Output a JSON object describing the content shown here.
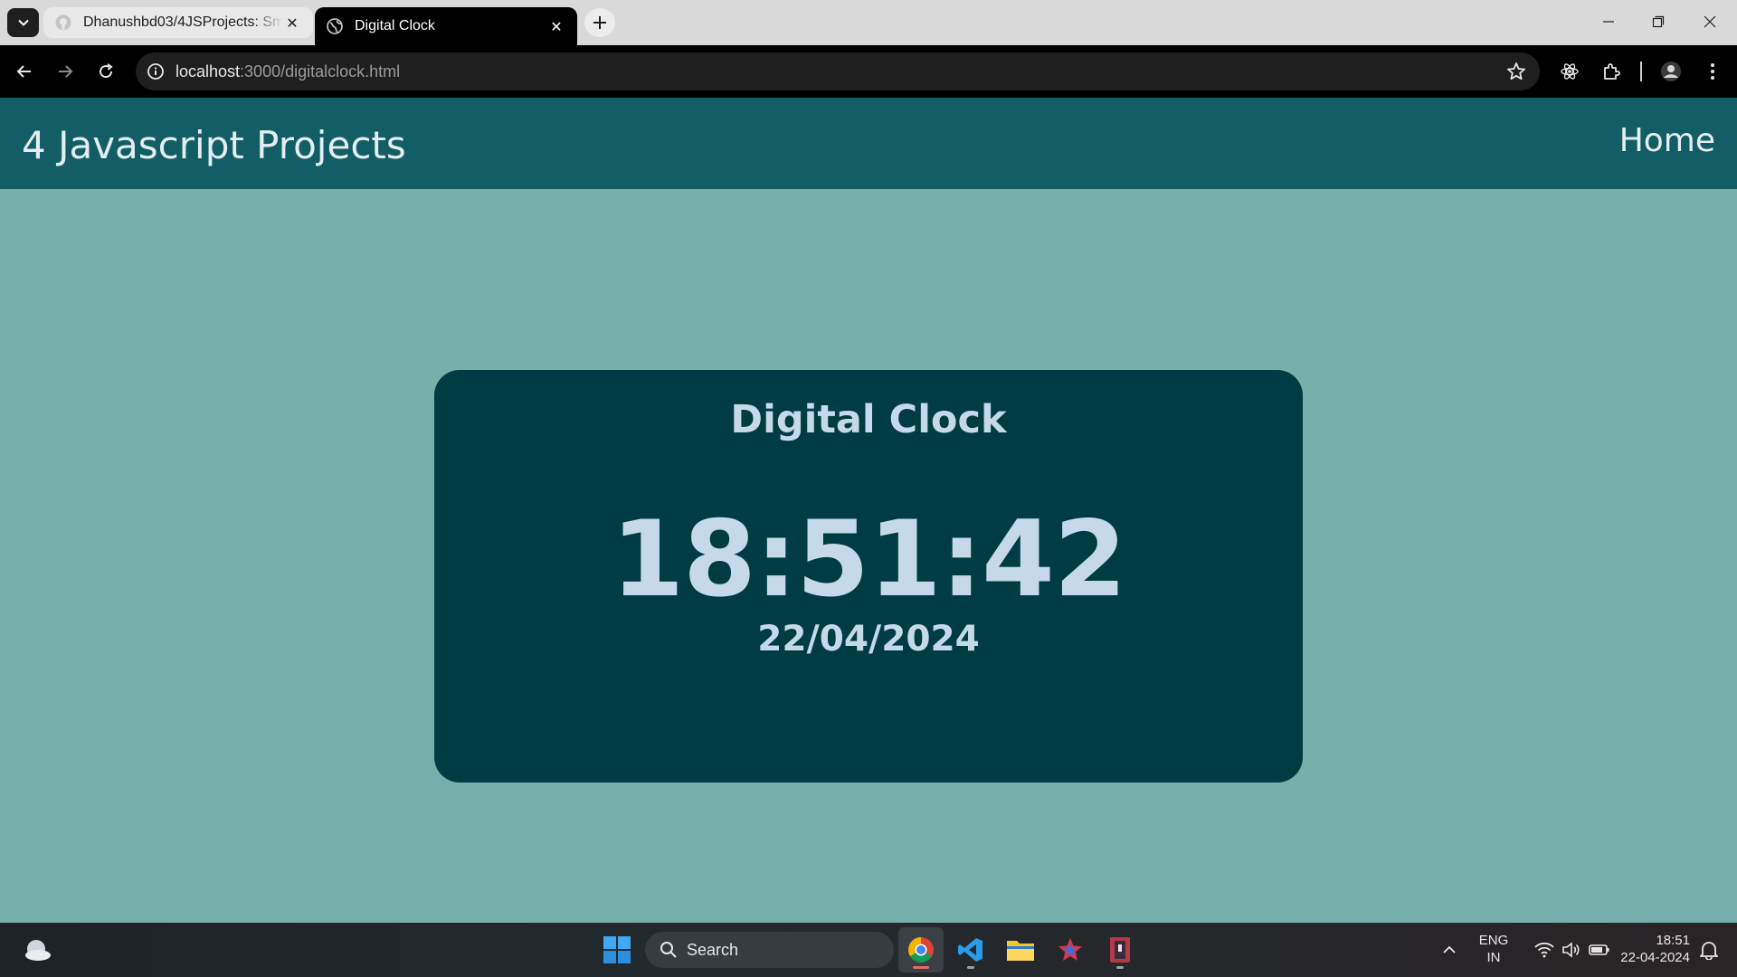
{
  "browser": {
    "tabs": [
      {
        "title": "Dhanushbd03/4JSProjects: Sm",
        "favicon": "github-icon",
        "active": false
      },
      {
        "title": "Digital Clock",
        "favicon": "globe-icon",
        "active": true
      }
    ],
    "url_host": "localhost",
    "url_rest": ":3000/digitalclock.html"
  },
  "site": {
    "title": "4 Javascript Projects",
    "nav_home": "Home"
  },
  "clock": {
    "heading": "Digital Clock",
    "time": "18:51:42",
    "date": "22/04/2024"
  },
  "taskbar": {
    "search_placeholder": "Search",
    "lang_line1": "ENG",
    "lang_line2": "IN",
    "time": "18:51",
    "date": "22-04-2024"
  },
  "colors": {
    "page_bg": "#77b0aa",
    "header_bg": "#135d66",
    "card_bg": "#003c43",
    "text_light": "#c5d9ea"
  }
}
